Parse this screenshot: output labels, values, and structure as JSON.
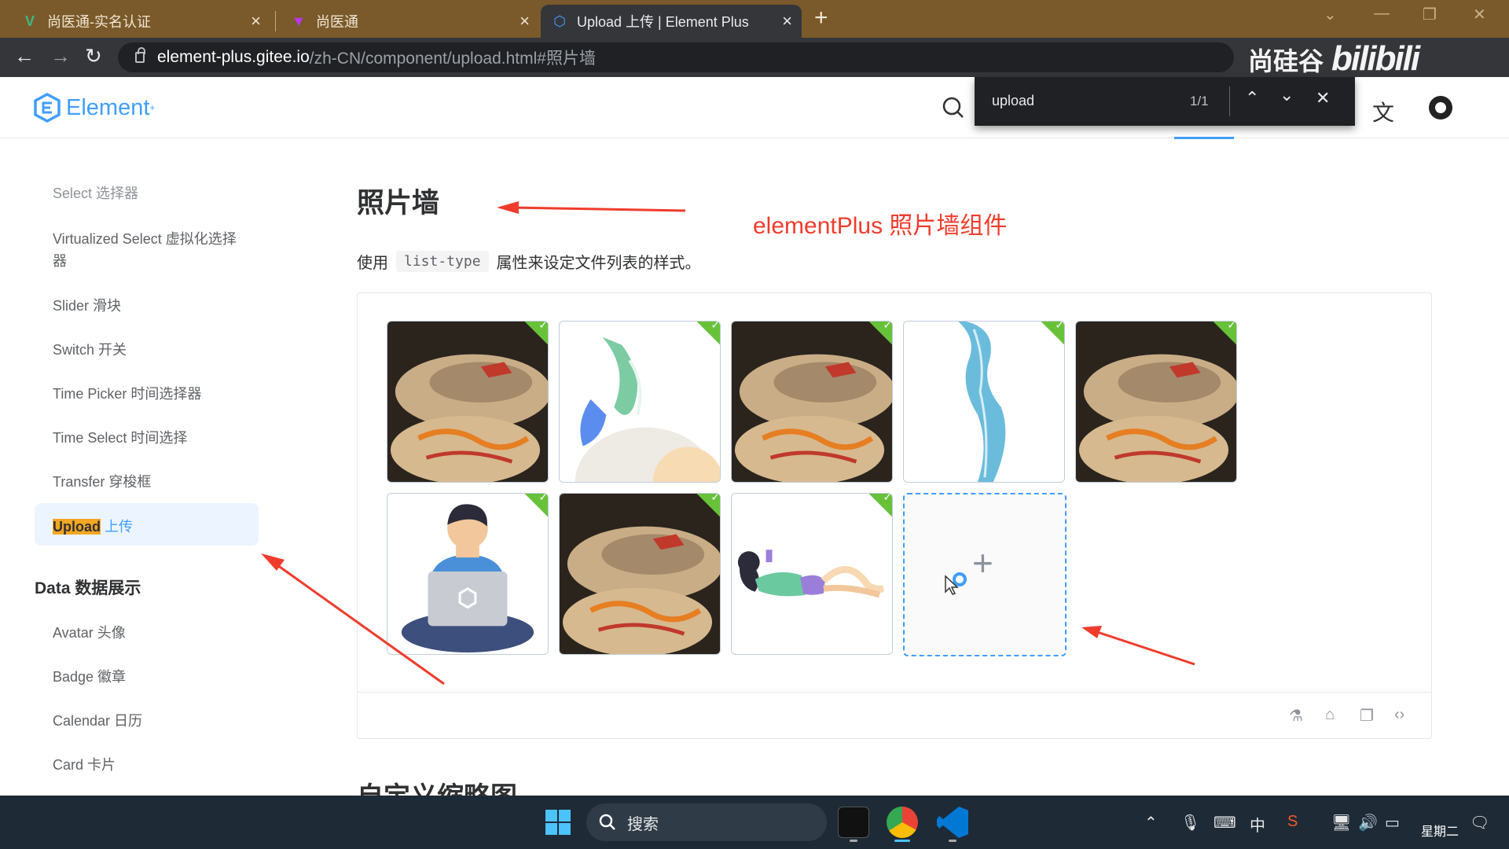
{
  "browser": {
    "tabs": [
      {
        "title": "尚医通-实名认证",
        "active": false
      },
      {
        "title": "尚医通",
        "active": false
      },
      {
        "title": "Upload 上传 | Element Plus",
        "active": true
      }
    ],
    "url_host": "element-plus.gitee.io",
    "url_path": "/zh-CN/component/upload.html#照片墙",
    "watermark": "尚硅谷",
    "watermark_brand": "bilibili"
  },
  "header": {
    "logo": "Element",
    "logo_sup": "+"
  },
  "findbar": {
    "query": "upload",
    "count": "1/1"
  },
  "sidebar": {
    "items_top": [
      {
        "label": "Select 选择器"
      },
      {
        "label": "Virtualized Select 虚拟化选择"
      },
      {
        "label": "器"
      },
      {
        "label": "Slider 滑块"
      },
      {
        "label": "Switch 开关"
      },
      {
        "label": "Time Picker 时间选择器"
      },
      {
        "label": "Time Select 时间选择"
      },
      {
        "label": "Transfer 穿梭框"
      }
    ],
    "active_highlight": "Upload",
    "active_rest": " 上传",
    "section": "Data 数据展示",
    "items_bottom": [
      {
        "label": "Avatar 头像"
      },
      {
        "label": "Badge 徽章"
      },
      {
        "label": "Calendar 日历"
      },
      {
        "label": "Card 卡片"
      }
    ]
  },
  "content": {
    "title": "照片墙",
    "annotation": "elementPlus 照片墙组件",
    "desc_before": "使用",
    "desc_code": "list-type",
    "desc_after": "属性来设定文件列表的样式。",
    "next_title": "自定义缩略图"
  },
  "upload_cards": [
    {
      "image": "food-photo",
      "status": "success"
    },
    {
      "image": "plant-illustration",
      "status": "success"
    },
    {
      "image": "food-photo",
      "status": "success"
    },
    {
      "image": "river-illustration",
      "status": "success"
    },
    {
      "image": "food-photo",
      "status": "success"
    },
    {
      "image": "person-laptop-illustration",
      "status": "success"
    },
    {
      "image": "food-photo",
      "status": "success"
    },
    {
      "image": "person-reading-illustration",
      "status": "success"
    }
  ],
  "taskbar": {
    "search_placeholder": "搜索",
    "ime": "中",
    "weekday": "星期二"
  },
  "colors": {
    "primary": "#409eff",
    "success": "#67c23a",
    "annotation_red": "#f03c2c",
    "tabstrip": "#7a5a2a",
    "taskbar": "#1e2a36"
  }
}
